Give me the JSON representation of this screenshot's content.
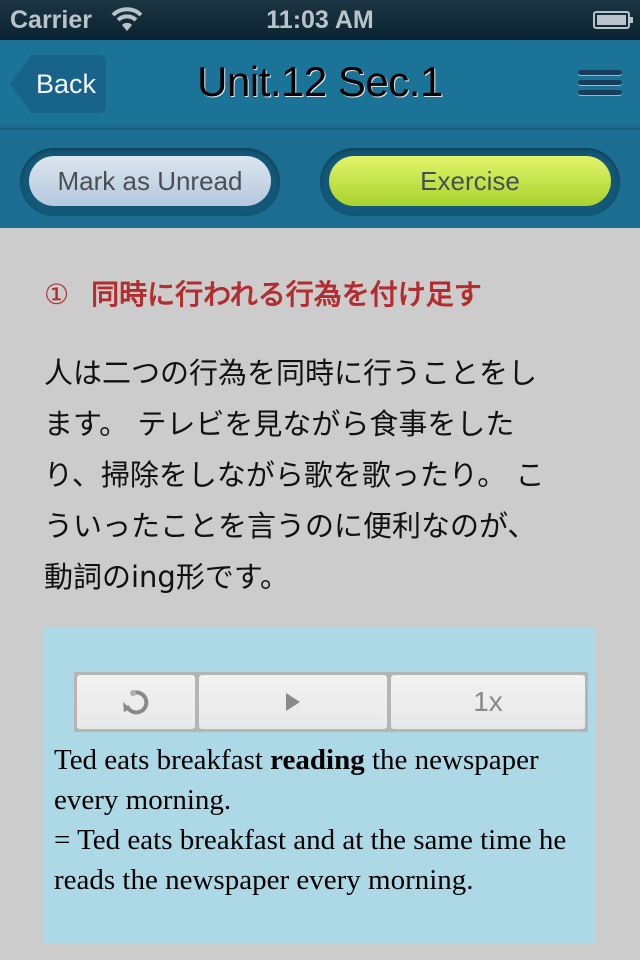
{
  "status_bar": {
    "carrier": "Carrier",
    "time": "11:03 AM",
    "wifi_icon": "wifi-icon",
    "battery_icon": "battery-icon"
  },
  "nav": {
    "back_label": "Back",
    "title": "Unit.12 Sec.1",
    "menu_icon": "hamburger-menu-icon"
  },
  "toolbar": {
    "mark_unread_label": "Mark as Unread",
    "exercise_label": "Exercise"
  },
  "section": {
    "number": "①",
    "heading": "同時に行われる行為を付け足す",
    "body_lines": [
      "人は二つの行為を同時に行うことをし",
      "ます。 テレビを見ながら食事をした",
      "り、掃除をしながら歌を歌ったり。 こ",
      "ういったことを言うのに便利なのが、",
      "動詞のing形です。"
    ]
  },
  "example": {
    "player": {
      "restart_icon": "restart-icon",
      "play_icon": "play-icon",
      "speed_label": "1x"
    },
    "sentence_prefix": "Ted eats breakfast ",
    "sentence_bold": "reading",
    "sentence_suffix": " the newspaper every morning.",
    "explanation": "= Ted eats breakfast and at the same time he reads the newspaper every morning."
  },
  "colors": {
    "nav_bg": "#1c7398",
    "heading_red": "#b22d2f",
    "example_bg": "#add8e6",
    "exercise_green": "#c9e84a",
    "unread_blue": "#c8d6e8"
  }
}
